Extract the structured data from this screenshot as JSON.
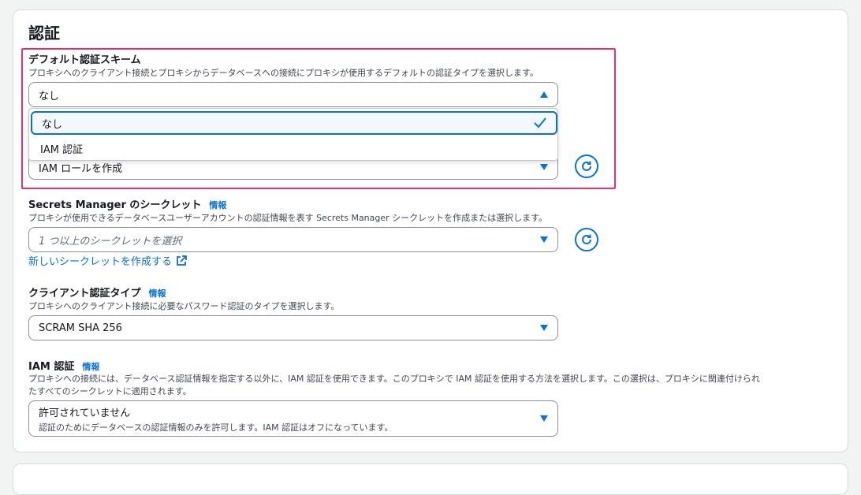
{
  "section": {
    "title": "認証"
  },
  "default_scheme": {
    "label": "デフォルト認証スキーム",
    "description": "プロキシへのクライアント接続とプロキシからデータベースへの接続にプロキシが使用するデフォルトの認証タイプを選択します。",
    "value": "なし",
    "options": [
      "なし",
      "IAM 認証"
    ]
  },
  "iam_role": {
    "value": "IAM ロールを作成"
  },
  "secrets": {
    "label": "Secrets Manager のシークレット",
    "info": "情報",
    "description": "プロキシが使用できるデータベースユーザーアカウントの認証情報を表す Secrets Manager シークレットを作成または選択します。",
    "placeholder": "1 つ以上のシークレットを選択",
    "create_link": "新しいシークレットを作成する"
  },
  "client_auth": {
    "label": "クライアント認証タイプ",
    "info": "情報",
    "description": "プロキシへのクライアント接続に必要なパスワード認証のタイプを選択します。",
    "value": "SCRAM SHA 256"
  },
  "iam_auth": {
    "label": "IAM 認証",
    "info": "情報",
    "description_line1": "プロキシへの接続には、データベース認証情報を指定する以外に、IAM 認証を使用できます。このプロキシで IAM 認証を使用する方法を選択します。この選択は、プロキシに関連付けられ",
    "description_line2": "たすべてのシークレットに適用されます。",
    "value": "許可されていません",
    "value_description": "認証のためにデータベースの認証情報のみを許可します。IAM 認証はオフになっています。"
  },
  "colors": {
    "accent": "#0972d3",
    "highlight": "#e8336f"
  }
}
